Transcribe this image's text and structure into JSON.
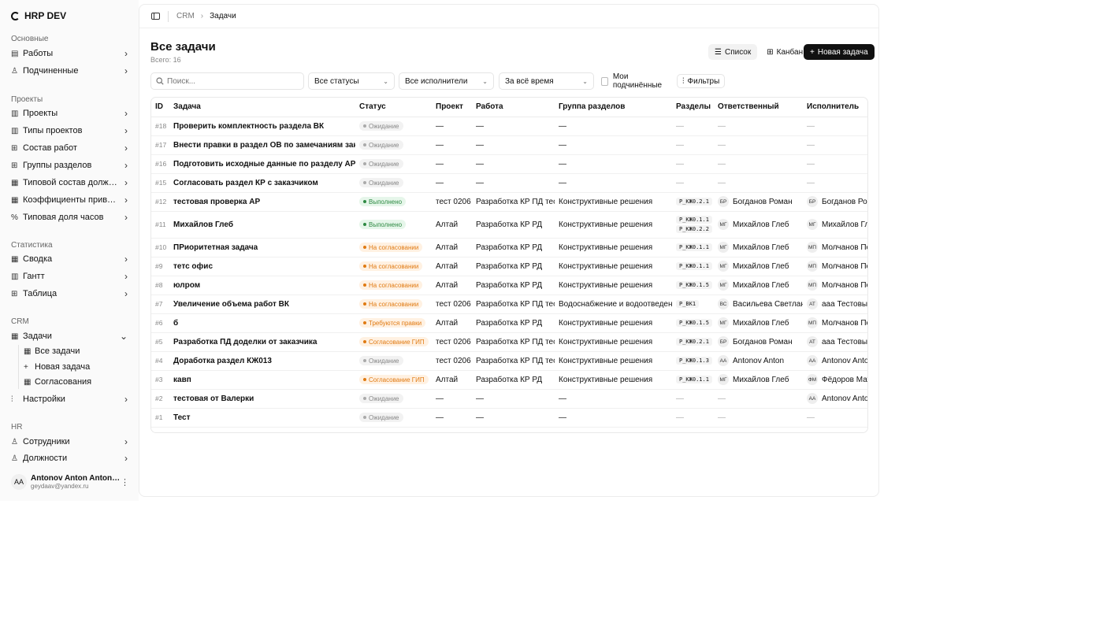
{
  "app": {
    "name": "HRP DEV"
  },
  "sidebar": {
    "sections": [
      "Основные",
      "Проекты",
      "Статистика",
      "CRM",
      "HR"
    ],
    "items": [
      {
        "label": "Работы",
        "icon": "briefcase-icon"
      },
      {
        "label": "Подчиненные",
        "icon": "user-icon"
      },
      {
        "label": "Проекты",
        "icon": "building-icon"
      },
      {
        "label": "Типы проектов",
        "icon": "building-icon"
      },
      {
        "label": "Состав работ",
        "icon": "grid-icon"
      },
      {
        "label": "Группы разделов",
        "icon": "grid-icon"
      },
      {
        "label": "Типовой состав должност...",
        "icon": "clipboard-icon"
      },
      {
        "label": "Коэффициенты приведени...",
        "icon": "calculator-icon"
      },
      {
        "label": "Типовая доля часов",
        "icon": "percent-icon"
      },
      {
        "label": "Сводка",
        "icon": "clipboard-icon"
      },
      {
        "label": "Гантт",
        "icon": "chart-icon"
      },
      {
        "label": "Таблица",
        "icon": "table-icon"
      },
      {
        "label": "Задачи",
        "icon": "clipboard-icon"
      },
      {
        "label": "Настройки",
        "icon": "sliders-icon"
      },
      {
        "label": "Сотрудники",
        "icon": "users-icon"
      },
      {
        "label": "Должности",
        "icon": "org-icon"
      }
    ],
    "sub_items": [
      {
        "label": "Все задачи"
      },
      {
        "label": "Новая задача"
      },
      {
        "label": "Согласования"
      }
    ],
    "user": {
      "initials": "AA",
      "name": "Antonov Anton Antonovi...",
      "email": "geydaav@yandex.ru"
    }
  },
  "breadcrumb": {
    "root": "CRM",
    "current": "Задачи"
  },
  "page": {
    "title": "Все задачи",
    "count": "Всего: 16"
  },
  "toolbar": {
    "list": "Список",
    "kanban": "Канбан",
    "new_task": "Новая задача"
  },
  "filters": {
    "search_placeholder": "Поиск...",
    "status": "Все статусы",
    "assignee": "Все исполнители",
    "period": "За всё время",
    "my_subordinates": "Мои подчинённые",
    "filters_button": "Фильтры"
  },
  "table": {
    "columns": [
      "ID",
      "Задача",
      "Статус",
      "Проект",
      "Работа",
      "Группа разделов",
      "Разделы",
      "Ответственный",
      "Исполнитель"
    ],
    "rows": [
      {
        "id": "#18",
        "task": "Проверить комплектность раздела ВК",
        "status": "Ожидание",
        "project": "—",
        "work": "—",
        "group": "—",
        "sections": [
          "—"
        ],
        "resp_init": "",
        "resp": "—",
        "exec_init": "",
        "exec": "—"
      },
      {
        "id": "#17",
        "task": "Внести правки в раздел ОВ по замечаниям заказчика",
        "status": "Ожидание",
        "project": "—",
        "work": "—",
        "group": "—",
        "sections": [
          "—"
        ],
        "resp_init": "",
        "resp": "—",
        "exec_init": "",
        "exec": "—"
      },
      {
        "id": "#16",
        "task": "Подготовить исходные данные по разделу АР",
        "status": "Ожидание",
        "project": "—",
        "work": "—",
        "group": "—",
        "sections": [
          "—"
        ],
        "resp_init": "",
        "resp": "—",
        "exec_init": "",
        "exec": "—"
      },
      {
        "id": "#15",
        "task": "Согласовать раздел КР с заказчиком",
        "status": "Ожидание",
        "project": "—",
        "work": "—",
        "group": "—",
        "sections": [
          "—"
        ],
        "resp_init": "",
        "resp": "—",
        "exec_init": "",
        "exec": "—"
      },
      {
        "id": "#12",
        "task": "тестовая проверка АР",
        "status": "Выполнено",
        "project": "тест 0206",
        "work": "Разработка КР ПД тест",
        "group": "Конструктивные решения",
        "sections": [
          "Р_КЖ0.2.1"
        ],
        "resp_init": "БР",
        "resp": "Богданов Роман",
        "exec_init": "БР",
        "exec": "Богданов Роман"
      },
      {
        "id": "#11",
        "task": "Михайлов Глеб",
        "status": "Выполнено",
        "project": "Алтай",
        "work": "Разработка КР РД",
        "group": "Конструктивные решения",
        "sections": [
          "Р_КЖ0.1.1",
          "Р_КЖ0.2.2"
        ],
        "resp_init": "МГ",
        "resp": "Михайлов Глеб",
        "exec_init": "МГ",
        "exec": "Михайлов Глеб"
      },
      {
        "id": "#10",
        "task": "ПРиоритетная задача",
        "status": "На согласовании",
        "project": "Алтай",
        "work": "Разработка КР РД",
        "group": "Конструктивные решения",
        "sections": [
          "Р_КЖ0.1.1"
        ],
        "resp_init": "МГ",
        "resp": "Михайлов Глеб",
        "exec_init": "МП",
        "exec": "Молчанов Петр"
      },
      {
        "id": "#9",
        "task": "тетс офис",
        "status": "На согласовании",
        "project": "Алтай",
        "work": "Разработка КР РД",
        "group": "Конструктивные решения",
        "sections": [
          "Р_КЖ0.1.1"
        ],
        "resp_init": "МГ",
        "resp": "Михайлов Глеб",
        "exec_init": "МП",
        "exec": "Молчанов Петр"
      },
      {
        "id": "#8",
        "task": "юлром",
        "status": "На согласовании",
        "project": "Алтай",
        "work": "Разработка КР РД",
        "group": "Конструктивные решения",
        "sections": [
          "Р_КЖ0.1.5"
        ],
        "resp_init": "МГ",
        "resp": "Михайлов Глеб",
        "exec_init": "МП",
        "exec": "Молчанов Петр"
      },
      {
        "id": "#7",
        "task": "Увеличение объема работ ВК",
        "status": "На согласовании",
        "project": "тест 0206",
        "work": "Разработка КР ПД тест",
        "group": "Водоснабжение и водоотведение",
        "sections": [
          "Р_ВК1"
        ],
        "resp_init": "ВС",
        "resp": "Васильева Светлана",
        "exec_init": "АТ",
        "exec": "ааа Тестовый"
      },
      {
        "id": "#6",
        "task": "б",
        "status": "Требуются правки",
        "project": "Алтай",
        "work": "Разработка КР РД",
        "group": "Конструктивные решения",
        "sections": [
          "Р_КЖ0.1.5"
        ],
        "resp_init": "МГ",
        "resp": "Михайлов Глеб",
        "exec_init": "МП",
        "exec": "Молчанов Петр"
      },
      {
        "id": "#5",
        "task": "Разработка ПД доделки от заказчика",
        "status": "Согласование ГИП",
        "project": "тест 0206",
        "work": "Разработка КР ПД тест",
        "group": "Конструктивные решения",
        "sections": [
          "Р_КЖ0.2.1"
        ],
        "resp_init": "БР",
        "resp": "Богданов Роман",
        "exec_init": "АТ",
        "exec": "ааа Тестовый"
      },
      {
        "id": "#4",
        "task": "Доработка раздел КЖ013",
        "status": "Ожидание",
        "project": "тест 0206",
        "work": "Разработка КР ПД тест",
        "group": "Конструктивные решения",
        "sections": [
          "Р_КЖ0.1.3"
        ],
        "resp_init": "AA",
        "resp": "Antonov Anton",
        "exec_init": "AA",
        "exec": "Antonov Anton"
      },
      {
        "id": "#3",
        "task": "кавп",
        "status": "Согласование ГИП",
        "project": "Алтай",
        "work": "Разработка КР РД",
        "group": "Конструктивные решения",
        "sections": [
          "Р_КЖ0.1.1"
        ],
        "resp_init": "МГ",
        "resp": "Михайлов Глеб",
        "exec_init": "ФМ",
        "exec": "Фёдоров Матвей"
      },
      {
        "id": "#2",
        "task": "тестовая от Валерки",
        "status": "Ожидание",
        "project": "—",
        "work": "—",
        "group": "—",
        "sections": [
          "—"
        ],
        "resp_init": "",
        "resp": "—",
        "exec_init": "AA",
        "exec": "Antonov Anton"
      },
      {
        "id": "#1",
        "task": "Тест",
        "status": "Ожидание",
        "project": "—",
        "work": "—",
        "group": "—",
        "sections": [
          "—"
        ],
        "resp_init": "",
        "resp": "—",
        "exec_init": "",
        "exec": "—"
      }
    ]
  },
  "colors": {
    "primary": "#111111",
    "done": "#2e8a43",
    "pending": "#e07a12",
    "waiting": "#888888"
  }
}
